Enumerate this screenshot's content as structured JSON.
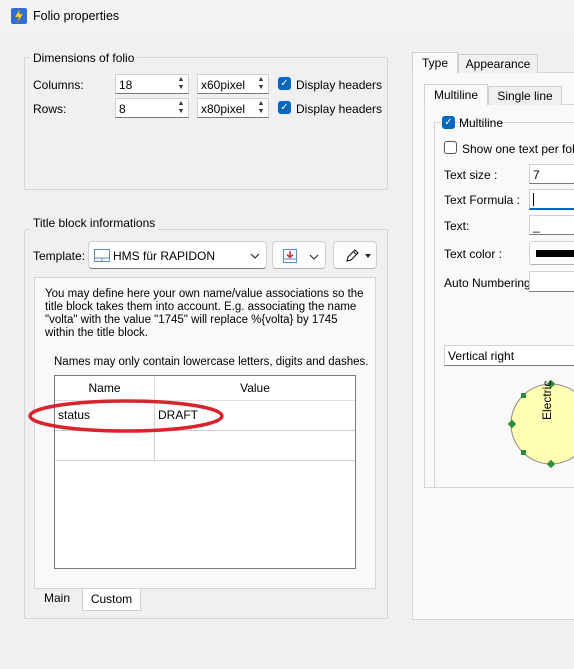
{
  "window": {
    "title": "Folio properties"
  },
  "dimensions": {
    "group_label": "Dimensions of folio",
    "columns_label": "Columns:",
    "columns_value": "18",
    "columns_unit": "x60pixel",
    "columns_headers": "Display headers",
    "rows_label": "Rows:",
    "rows_value": "8",
    "rows_unit": "x80pixel",
    "rows_headers": "Display headers"
  },
  "titleblock": {
    "group_label": "Title block informations",
    "template_label": "Template:",
    "template_value": "HMS für RAPIDON",
    "info_text": "You may define here your own name/value associations so the title block takes them into account. E.g. associating the name \"volta\" with the value \"1745\" will replace %{volta} by 1745 within the title block.",
    "names_note": "Names may only contain lowercase letters, digits and dashes.",
    "table": {
      "headers": [
        "Name",
        "Value"
      ],
      "rows": [
        {
          "name": "status",
          "value": "DRAFT"
        },
        {
          "name": "",
          "value": ""
        }
      ]
    },
    "tabs": [
      "Main",
      "Custom"
    ],
    "highlight_color": "#d9232d"
  },
  "right_panel": {
    "outer_tabs": [
      "Type",
      "Appearance"
    ],
    "inner_tabs": [
      "Multiline",
      "Single line"
    ],
    "multiline_label": "Multiline",
    "show_one_text": "Show one text per folio",
    "text_size_label": "Text size :",
    "text_size_value": "7",
    "text_formula_label": "Text Formula :",
    "text_formula_value": "",
    "text_label": "Text:",
    "text_value": "_",
    "text_color_label": "Text color :",
    "text_color": "#000000",
    "auto_numbering_label": "Auto Numbering",
    "orientation_value": "Vertical right",
    "preview_text": "Electric",
    "preview_fill": "#ffffb3",
    "handle_color": "#2e8b3a"
  }
}
